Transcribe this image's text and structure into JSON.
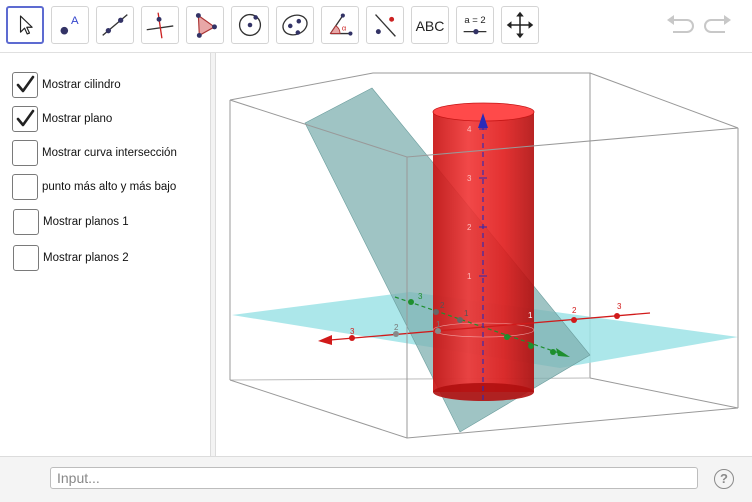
{
  "toolbar": {
    "tools": [
      {
        "name": "move-tool",
        "icon": "cursor-arrow-icon"
      },
      {
        "name": "point-tool",
        "icon": "point-icon"
      },
      {
        "name": "line-tool",
        "icon": "line-icon"
      },
      {
        "name": "perpendicular-line-tool",
        "icon": "perpendicular-line-icon"
      },
      {
        "name": "polygon-tool",
        "icon": "polygon-icon"
      },
      {
        "name": "circle-center-point-tool",
        "icon": "circle-icon"
      },
      {
        "name": "conic-tool",
        "icon": "ellipse-icon"
      },
      {
        "name": "angle-tool",
        "icon": "angle-icon"
      },
      {
        "name": "reflect-tool",
        "icon": "reflect-icon"
      },
      {
        "name": "text-tool",
        "label": "ABC"
      },
      {
        "name": "slider-tool",
        "label": "a = 2"
      },
      {
        "name": "move-graphics-view-tool",
        "icon": "move-arrows-icon"
      }
    ],
    "undo_icon": "undo-icon",
    "redo_icon": "redo-icon"
  },
  "checkboxes": [
    {
      "label": "Mostrar cilindro",
      "checked": true
    },
    {
      "label": "Mostrar plano",
      "checked": true
    },
    {
      "label": "Mostrar curva intersección",
      "checked": false
    },
    {
      "label": "punto más alto y más bajo",
      "checked": false
    },
    {
      "label": "Mostrar planos 1",
      "checked": false
    },
    {
      "label": "Mostrar planos 2",
      "checked": false
    }
  ],
  "graphics": {
    "z_ticks": [
      "1",
      "2",
      "3",
      "4"
    ],
    "x_ticks": [
      "3",
      "2",
      "1",
      "1",
      "2",
      "3"
    ],
    "y_ticks": [
      "3",
      "2",
      "1"
    ],
    "colors": {
      "cylinder": "#e01b1b",
      "plane": "#7fb0b0",
      "xy_plane": "#9ee3e6",
      "x_axis": "#d11a1a",
      "y_axis": "#1e8f2e",
      "z_axis": "#2a2ab8"
    }
  },
  "input_bar": {
    "placeholder": "Input..."
  },
  "help_icon": "help-icon",
  "help_label": "?"
}
